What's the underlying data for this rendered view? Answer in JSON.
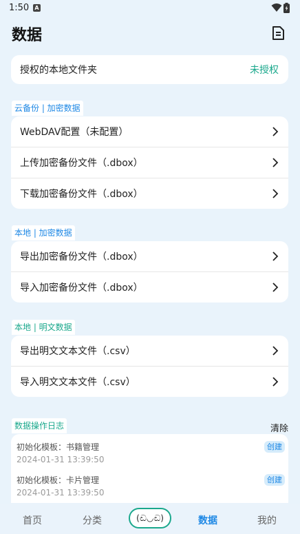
{
  "status_bar": {
    "time": "1:50",
    "notification_icon": "A"
  },
  "header": {
    "title": "数据",
    "doc_icon": "document-icon"
  },
  "auth_card": {
    "label": "授权的本地文件夹",
    "value": "未授权"
  },
  "sections": {
    "cloud": {
      "label": "云备份 | 加密数据",
      "items": [
        "WebDAV配置（未配置）",
        "上传加密备份文件（.dbox）",
        "下载加密备份文件（.dbox）"
      ]
    },
    "local_encrypted": {
      "label": "本地 | 加密数据",
      "items": [
        "导出加密备份文件（.dbox）",
        "导入加密备份文件（.dbox）"
      ]
    },
    "local_plain": {
      "label": "本地 | 明文数据",
      "items": [
        "导出明文文本文件（.csv）",
        "导入明文文本文件（.csv）"
      ]
    }
  },
  "log": {
    "label": "数据操作日志",
    "clear": "清除",
    "entries": [
      {
        "title": "初始化模板：书籍管理",
        "time": "2024-01-31 13:39:50",
        "badge": "创建"
      },
      {
        "title": "初始化模板：卡片管理",
        "time": "2024-01-31 13:39:50",
        "badge": "创建"
      }
    ]
  },
  "nav": {
    "home": "首页",
    "category": "分类",
    "center": "(ඬ◡ඬ)",
    "data": "数据",
    "mine": "我的"
  },
  "colors": {
    "accent_blue": "#1e88e5",
    "accent_teal": "#1aa88c",
    "background": "#e9f3fb"
  }
}
